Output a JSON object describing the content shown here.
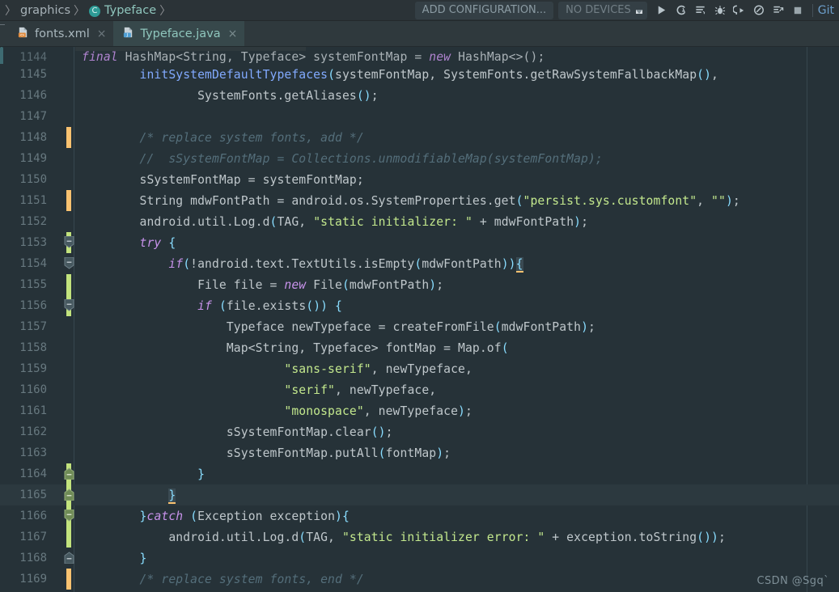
{
  "window": {
    "app": "Android Studio",
    "watermark": "CSDN @Sgq`"
  },
  "breadcrumb": {
    "lead_sep": "〉",
    "items": [
      {
        "label": "graphics",
        "icon": "",
        "sep": "〉"
      },
      {
        "label": "Typeface",
        "icon": "class-icon",
        "icon_letter": "C",
        "sep": "〉"
      }
    ]
  },
  "toolbar": {
    "run_configuration": "ADD CONFIGURATION...",
    "device_selector": "NO DEVICES",
    "git_label": "Git",
    "icons": [
      {
        "name": "run-icon",
        "title": "Run"
      },
      {
        "name": "run-coverage-icon",
        "title": "Run with Coverage"
      },
      {
        "name": "profile-icon",
        "title": "Profile"
      },
      {
        "name": "debug-icon",
        "title": "Debug"
      },
      {
        "name": "attach-debugger-icon",
        "title": "Attach Debugger"
      },
      {
        "name": "profiler-icon",
        "title": "Profiler"
      },
      {
        "name": "apply-changes-icon",
        "title": "Apply Changes"
      },
      {
        "name": "stop-icon",
        "title": "Stop"
      }
    ]
  },
  "tabs": [
    {
      "label": "fonts.xml",
      "icon": "xml-file-icon",
      "close": "×",
      "active": false
    },
    {
      "label": "Typeface.java",
      "icon": "java-file-icon",
      "close": "×",
      "active": true
    }
  ],
  "editor": {
    "first_partial_line": {
      "number": "1144",
      "text": "final HashMap<String, Typeface> systemFontMap = new HashMap<>();"
    },
    "lines": [
      {
        "number": "1145",
        "vcs": "none",
        "fold": "none"
      },
      {
        "number": "1146",
        "vcs": "none",
        "fold": "none"
      },
      {
        "number": "1147",
        "vcs": "none",
        "fold": "none"
      },
      {
        "number": "1148",
        "vcs": "changed",
        "fold": "none"
      },
      {
        "number": "1149",
        "vcs": "none",
        "fold": "none"
      },
      {
        "number": "1150",
        "vcs": "none",
        "fold": "none"
      },
      {
        "number": "1151",
        "vcs": "changed",
        "fold": "none"
      },
      {
        "number": "1152",
        "vcs": "none",
        "fold": "none"
      },
      {
        "number": "1153",
        "vcs": "added",
        "fold": "collapse"
      },
      {
        "number": "1154",
        "vcs": "none",
        "fold": "collapse"
      },
      {
        "number": "1155",
        "vcs": "added",
        "fold": "none"
      },
      {
        "number": "1156",
        "vcs": "added",
        "fold": "collapse"
      },
      {
        "number": "1157",
        "vcs": "none",
        "fold": "none"
      },
      {
        "number": "1158",
        "vcs": "none",
        "fold": "none"
      },
      {
        "number": "1159",
        "vcs": "none",
        "fold": "none"
      },
      {
        "number": "1160",
        "vcs": "none",
        "fold": "none"
      },
      {
        "number": "1161",
        "vcs": "none",
        "fold": "none"
      },
      {
        "number": "1162",
        "vcs": "none",
        "fold": "none"
      },
      {
        "number": "1163",
        "vcs": "none",
        "fold": "none"
      },
      {
        "number": "1164",
        "vcs": "added",
        "fold": "end"
      },
      {
        "number": "1165",
        "vcs": "added",
        "fold": "end",
        "current": true
      },
      {
        "number": "1166",
        "vcs": "added",
        "fold": "collapse"
      },
      {
        "number": "1167",
        "vcs": "added",
        "fold": "none"
      },
      {
        "number": "1168",
        "vcs": "none",
        "fold": "end"
      },
      {
        "number": "1169",
        "vcs": "changed",
        "fold": "none"
      }
    ],
    "source_text": [
      "        initSystemDefaultTypefaces(systemFontMap, SystemFonts.getRawSystemFallbackMap(),",
      "                SystemFonts.getAliases());",
      "",
      "        /* replace system fonts, add */",
      "        //  sSystemFontMap = Collections.unmodifiableMap(systemFontMap);",
      "        sSystemFontMap = systemFontMap;",
      "        String mdwFontPath = android.os.SystemProperties.get(\"persist.sys.customfont\", \"\");",
      "        android.util.Log.d(TAG, \"static initializer: \" + mdwFontPath);",
      "        try {",
      "            if(!android.text.TextUtils.isEmpty(mdwFontPath)){",
      "                File file = new File(mdwFontPath);",
      "                if (file.exists()) {",
      "                    Typeface newTypeface = createFromFile(mdwFontPath);",
      "                    Map<String, Typeface> fontMap = Map.of(",
      "                            \"sans-serif\", newTypeface,",
      "                            \"serif\", newTypeface,",
      "                            \"monospace\", newTypeface);",
      "                    sSystemFontMap.clear();",
      "                    sSystemFontMap.putAll(fontMap);",
      "                }",
      "            }",
      "        }catch (Exception exception){",
      "            android.util.Log.d(TAG, \"static initializer error: \" + exception.toString());",
      "        }",
      "        /* replace system fonts, end */"
    ]
  },
  "colors": {
    "editor_bg": "#263238",
    "toolbar_bg": "#2b3337",
    "tabbar_bg": "#2f393d",
    "active_tab_bg": "#37484b",
    "current_line_bg": "#2c393f",
    "line_number": "#67787f",
    "keyword": "#c792ea",
    "string": "#c3e88d",
    "comment": "#546e7a",
    "punctuation": "#89ddff",
    "method": "#82aaff",
    "default_text": "#bfc7cb",
    "vcs_added": "#c2e37d",
    "vcs_changed": "#f9c270"
  }
}
